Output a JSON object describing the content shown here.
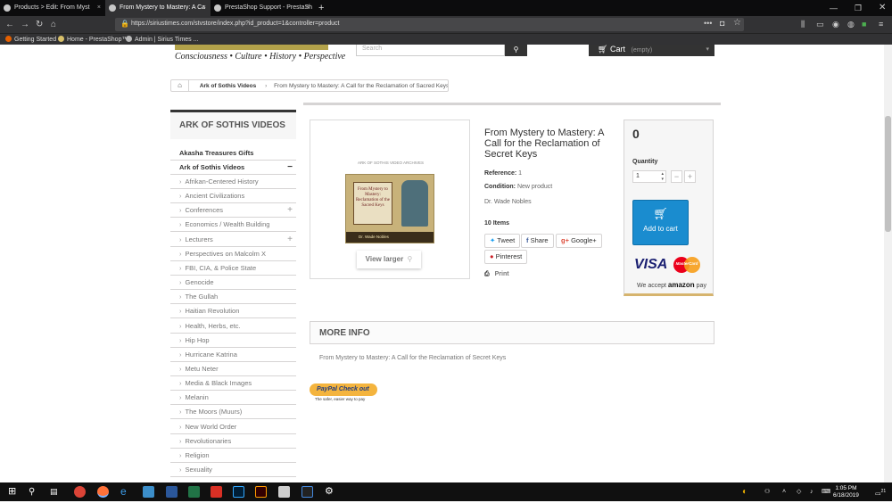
{
  "browser": {
    "tabs": [
      {
        "label": "Products > Edit: From Myst"
      },
      {
        "label": "From Mystery to Mastery: A Ca"
      },
      {
        "label": "PrestaShop Support - PrestaSh"
      }
    ],
    "new_tab": "+",
    "url": "https://siriustimes.com/stvstore/index.php?id_product=1&controller=product",
    "bookmarks": [
      "Getting Started",
      "Home - PrestaShop™",
      "Admin | Sirius Times ..."
    ]
  },
  "header": {
    "tagline": "Consciousness • Culture • History • Perspective",
    "search_placeholder": "Search",
    "cart_label": "Cart",
    "cart_status": "(empty)"
  },
  "breadcrumb": {
    "category": "Ark of Sothis Videos",
    "current": "From Mystery to Mastery: A Call for the Reclamation of Sacred Keys"
  },
  "sidebar": {
    "title": "ARK OF SOTHIS VIDEOS",
    "top_items": [
      "Akasha Treasures Gifts",
      "Ark of Sothis Videos"
    ],
    "expanded_toggle": "−",
    "sub_items": [
      "Afrikan-Centered History",
      "Ancient Civilizations",
      "Conferences",
      "Economics / Wealth Building",
      "Lecturers",
      "Perspectives on Malcolm X",
      "FBI, CIA, & Police State",
      "Genocide",
      "The Gullah",
      "Haitian Revolution",
      "Health, Herbs, etc.",
      "Hip Hop",
      "Hurricane Katrina",
      "Metu Neter",
      "Media & Black Images",
      "Melanin",
      "The Moors (Muurs)",
      "New World Order",
      "Revolutionaries",
      "Religion",
      "Sexuality"
    ],
    "plus_toggle": "+"
  },
  "product": {
    "cover_top": "ARK OF SOTHIS VIDEO ARCHIVES",
    "cover_title": "From Mystery to Mastery: Reclamation of the Sacred Keys",
    "cover_author": "Dr. Wade Nobles",
    "view_larger": "View larger",
    "title": "From Mystery to Mastery: A Call for the Reclamation of Secret Keys",
    "reference_label": "Reference:",
    "reference_value": "1",
    "condition_label": "Condition:",
    "condition_value": "New product",
    "author": "Dr. Wade Nobles",
    "items": "10 Items",
    "share": {
      "tweet": "Tweet",
      "share": "Share",
      "google": "Google+",
      "pinterest": "Pinterest"
    },
    "print": "Print"
  },
  "buy": {
    "price": "0",
    "quantity_label": "Quantity",
    "quantity_value": "1",
    "minus": "−",
    "plus": "+",
    "add_to_cart": "Add to cart",
    "visa": "VISA",
    "mastercard": "MasterCard",
    "amazon_text": "We accept",
    "amazon_brand": "amazon",
    "amazon_pay": "pay"
  },
  "more_info": {
    "heading": "MORE INFO",
    "description": "From Mystery to Mastery: A Call for the Reclamation of Secret Keys"
  },
  "paypal": {
    "button": "PayPal Check out",
    "subtitle": "The safer, easier way to pay"
  },
  "taskbar": {
    "time": "1:05 PM",
    "date": "6/18/2019",
    "notifications": "21"
  },
  "colors": {
    "accent": "#1a8ccf",
    "dark": "#333333",
    "logo_gold": "#b3a24a"
  }
}
